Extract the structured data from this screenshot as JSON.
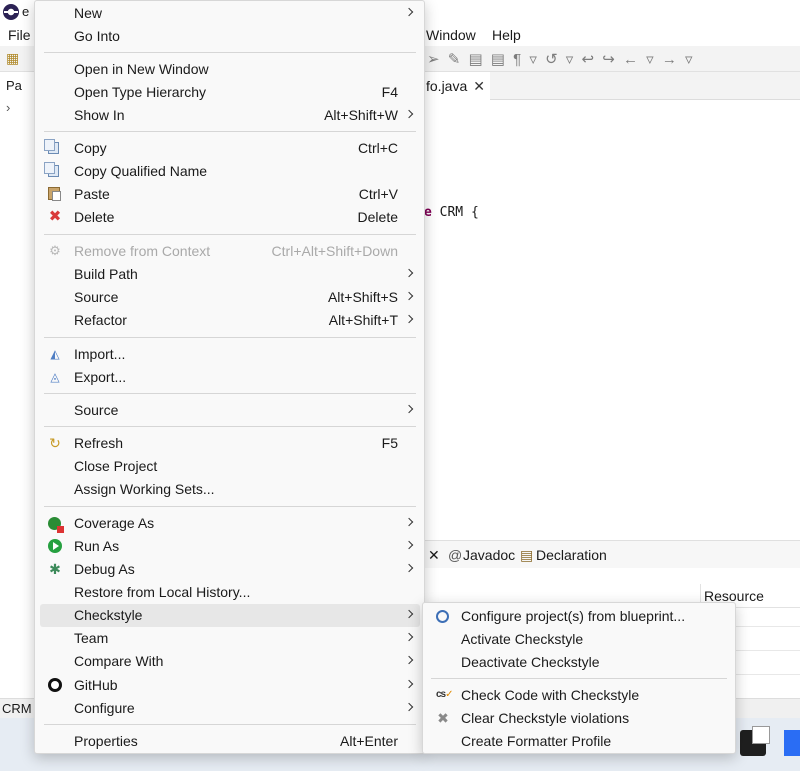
{
  "window": {
    "title_fragment": "e"
  },
  "menubar": {
    "file": "File",
    "window": "Window",
    "help": "Help"
  },
  "package_explorer": {
    "tab_fragment": "Pa"
  },
  "editor": {
    "tab_label": "fo.java",
    "code_keyword_fragment": "e",
    "code_rest": " CRM {"
  },
  "views": {
    "javadoc": "Javadoc",
    "declaration": "Declaration",
    "resource_column": "Resource"
  },
  "status": {
    "text": "CRM"
  },
  "context_menu": {
    "new": "New",
    "go_into": "Go Into",
    "open_new_window": "Open in New Window",
    "open_type_hierarchy": "Open Type Hierarchy",
    "open_type_hierarchy_shortcut": "F4",
    "show_in": "Show In",
    "show_in_shortcut": "Alt+Shift+W",
    "copy": "Copy",
    "copy_shortcut": "Ctrl+C",
    "copy_qualified_name": "Copy Qualified Name",
    "paste": "Paste",
    "paste_shortcut": "Ctrl+V",
    "delete": "Delete",
    "delete_shortcut": "Delete",
    "remove_from_context": "Remove from Context",
    "remove_from_context_shortcut": "Ctrl+Alt+Shift+Down",
    "build_path": "Build Path",
    "source": "Source",
    "source_shortcut": "Alt+Shift+S",
    "refactor": "Refactor",
    "refactor_shortcut": "Alt+Shift+T",
    "import": "Import...",
    "export": "Export...",
    "source2": "Source",
    "refresh": "Refresh",
    "refresh_shortcut": "F5",
    "close_project": "Close Project",
    "assign_working_sets": "Assign Working Sets...",
    "coverage_as": "Coverage As",
    "run_as": "Run As",
    "debug_as": "Debug As",
    "restore_local_history": "Restore from Local History...",
    "checkstyle": "Checkstyle",
    "team": "Team",
    "compare_with": "Compare With",
    "github": "GitHub",
    "configure": "Configure",
    "properties": "Properties",
    "properties_shortcut": "Alt+Enter"
  },
  "checkstyle_submenu": {
    "configure_blueprint": "Configure project(s) from blueprint...",
    "activate": "Activate Checkstyle",
    "deactivate": "Deactivate Checkstyle",
    "check_code": "Check Code with Checkstyle",
    "clear_violations": "Clear Checkstyle violations",
    "create_formatter": "Create Formatter Profile",
    "cs_icon_text": "cs"
  }
}
